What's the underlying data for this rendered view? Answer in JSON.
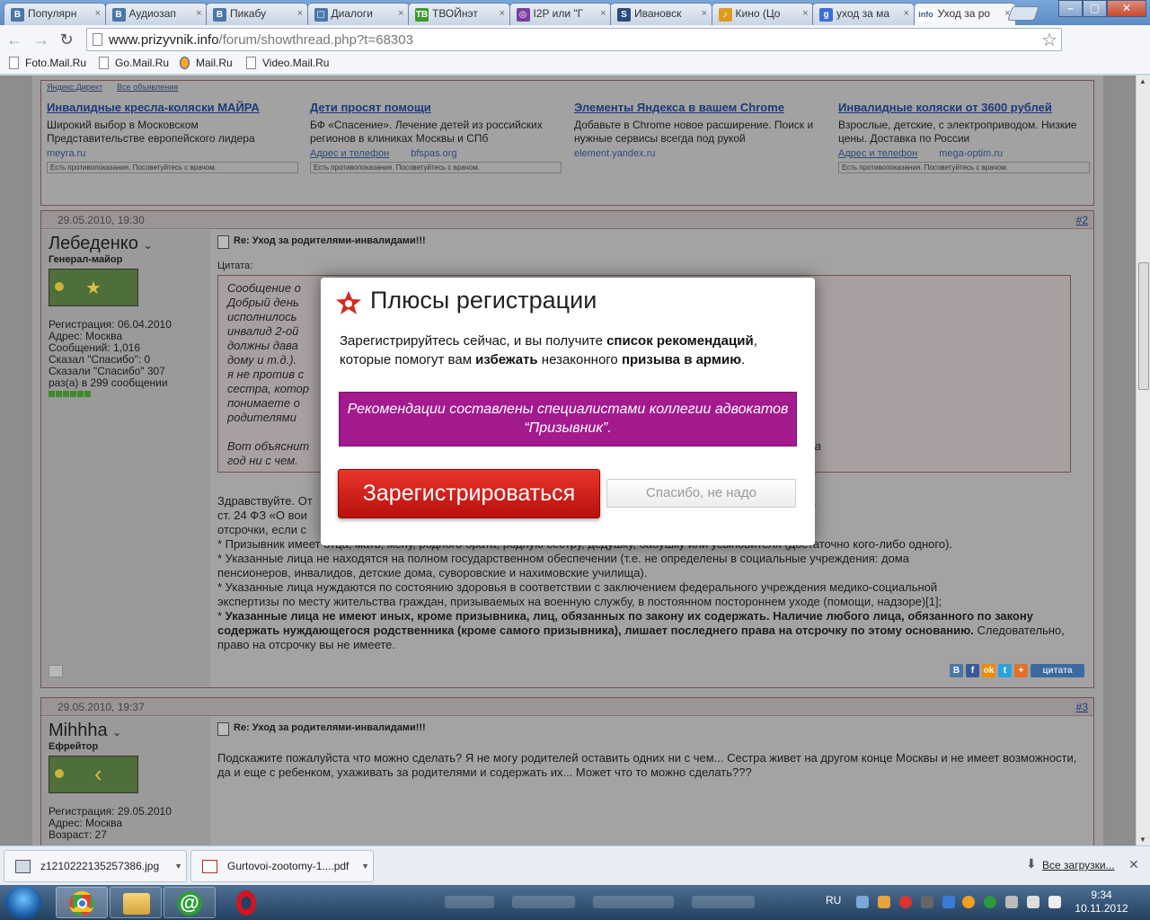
{
  "tabs": [
    {
      "label": "Популярн",
      "icon": "vk-icon",
      "color": "#4a76a8",
      "glyph": "B"
    },
    {
      "label": "Аудиозап",
      "icon": "vk-icon",
      "color": "#4a76a8",
      "glyph": "B"
    },
    {
      "label": "Пикабу",
      "icon": "vk-icon",
      "color": "#4a76a8",
      "glyph": "B"
    },
    {
      "label": "Диалоги",
      "icon": "chat-icon",
      "color": "#4a76a8",
      "glyph": "▢"
    },
    {
      "label": "ТВОЙнэт",
      "icon": "green-icon",
      "color": "#3a9a2c",
      "glyph": "ТВ"
    },
    {
      "label": "I2P или \"Г",
      "icon": "i2p-icon",
      "color": "#7a3fa0",
      "glyph": "◎"
    },
    {
      "label": "Ивановск",
      "icon": "site-icon",
      "color": "#2c4c7c",
      "glyph": "S"
    },
    {
      "label": "Кино (Цо",
      "icon": "music-icon",
      "color": "#e09a1a",
      "glyph": "♪"
    },
    {
      "label": "уход за ма",
      "icon": "google-icon",
      "color": "#3b6fd6",
      "glyph": "g"
    },
    {
      "label": "Уход за ро",
      "icon": "info-icon",
      "color": "#ffffff",
      "glyph": "info",
      "active": true
    }
  ],
  "address": {
    "domain": "www.prizyvnik.info",
    "path": "/forum/showthread.php?t=68303"
  },
  "bookmarks": [
    "Foto.Mail.Ru",
    "Go.Mail.Ru",
    "Mail.Ru",
    "Video.Mail.Ru"
  ],
  "ads": {
    "header": [
      "Яндекс.Директ",
      "Все объявления"
    ],
    "items": [
      {
        "title": "Инвалидные кресла-коляски МАЙРА",
        "text": "Широкий выбор в Московском Представительстве европейского лидера",
        "site": "meyra.ru",
        "extra": "",
        "warn": "Есть противопоказания. Посоветуйтесь с врачом."
      },
      {
        "title": "Дети просят помощи",
        "text": "БФ «Спасение». Лечение детей из российских регионов в клиниках Москвы и СПб",
        "site": "Адрес и телефон",
        "extra": "bfspas.org",
        "warn": "Есть противопоказания. Посоветуйтесь с врачом."
      },
      {
        "title": "Элементы Яндекса в вашем Chrome",
        "text": "Добавьте в Chrome новое расширение. Поиск и нужные сервисы всегда под рукой",
        "site": "element.yandex.ru",
        "extra": "",
        "warn": ""
      },
      {
        "title": "Инвалидные коляски от 3600 рублей",
        "text": "Взрослые, детские, с электроприводом. Низкие цены. Доставка по России",
        "site": "Адрес и телефон",
        "extra": "mega-optim.ru",
        "warn": "Есть противопоказания. Посоветуйтесь с врачом."
      }
    ]
  },
  "post1": {
    "date": "29.05.2010, 19:30",
    "number": "#2",
    "user": "Лебеденко",
    "rank": "Генерал-майор",
    "info": [
      "Регистрация: 06.04.2010",
      "Адрес: Москва",
      "Сообщений: 1,016",
      "Сказал \"Спасибо\": 0",
      "Сказали \"Спасибо\" 307",
      "раз(а) в 299 сообщении"
    ],
    "title": "Re: Уход за родителями-инвалидами!!!",
    "quote_label": "Цитата:",
    "quote_lines": [
      "Сообщение о",
      "Добрый день                                                                                           емию, отсрочки не будет, в марте",
      "исполнилось                                                                                           енсионер, инвалид 2-ой группы, мать",
      "инвалид 2-ой                                                                                          на лекарства, потому как те, которые",
      "должны дава                                                                                           Все делаю я один (магазины, дела по",
      "дому и т.д.).                                                                                          от армии и не уклонялся и в принципе",
      "я не против с                                                                                          в том, что у меня есть родная",
      "сестра, котор                                                                                          ебенком (1-й класс ходит) и как Вы",
      "понимаете о                                                                                            она в Царицыно, а надо что бы с",
      "родителями",
      "",
      "Вот объяснит                                                                                          ? Ну не могу я оставить родителей на",
      "год ни с чем."
    ],
    "body_lines": [
      "Здравствуйте. От                                                                                      енами семьи, предусмотрена пп. «б» п. 1",
      "ст. 24 ФЗ «О вои                                                                                      право требовать предоставления",
      "отсрочки, если с",
      "* Призывник имеет отца, мать, жену, родного брата, родную сестру, дедушку, бабушку или усыновителя (достаточно кого-либо одного).",
      "* Указанные лица не находятся на полном государственном обеспечении (т.е. не определены в социальные учреждения: дома",
      "пенсионеров, инвалидов, детские дома, суворовские и нахимовские училища).",
      "* Указанные лица нуждаются по состоянию здоровья в соответствии с заключением федерального учреждения медико-социальной",
      "экспертизы по месту жительства граждан, призываемых на военную службу, в постоянном постороннем уходе (помощи, надзоре)[1];"
    ],
    "bold_text": "Указанные лица не имеют иных, кроме призывника, лиц, обязанных по закону их содержать. Наличие любого лица, обязанного по закону содержать нуждающегося родственника (кроме самого призывника), лишает последнего права на отсрочку по этому основанию.",
    "tail_text": " Следовательно, право на отсрочку вы не имеете.",
    "cite_label": "цитата"
  },
  "post2": {
    "date": "29.05.2010, 19:37",
    "number": "#3",
    "user": "Mihhha",
    "rank": "Ефрейтор",
    "info": [
      "Регистрация: 29.05.2010",
      "Адрес: Москва",
      "Возраст: 27"
    ],
    "title": "Re: Уход за родителями-инвалидами!!!",
    "body": "Подскажите пожалуйста что можно сделать? Я не могу родителей оставить одних ни с чем... Сестра живет на другом конце Москвы и не имеет возможности, да и еще с ребенком, ухаживать за родителями и содержать их... Может что то можно сделать???"
  },
  "modal": {
    "title": "Плюсы регистрации",
    "text_parts": [
      "Зарегистрируйтесь сейчас, и вы получите ",
      "список рекомендаций",
      ", которые помогут вам ",
      "избежать",
      " незаконного ",
      "призыва в армию",
      "."
    ],
    "banner": "Рекомендации составлены специалистами коллегии адвокатов “Призывник”.",
    "register_label": "Зарегистрироваться",
    "decline_label": "Спасибо, не надо",
    "accent_color": "#a31a8e",
    "button_color": "#d42a22"
  },
  "downloads": [
    {
      "name": "z1210222135257386.jpg",
      "type": "image"
    },
    {
      "name": "Gurtovoi-zootomy-1....pdf",
      "type": "pdf"
    }
  ],
  "downloads_all": "Все загрузки...",
  "taskbar": {
    "lang": "RU",
    "time": "9:34",
    "date": "10.11.2012"
  }
}
